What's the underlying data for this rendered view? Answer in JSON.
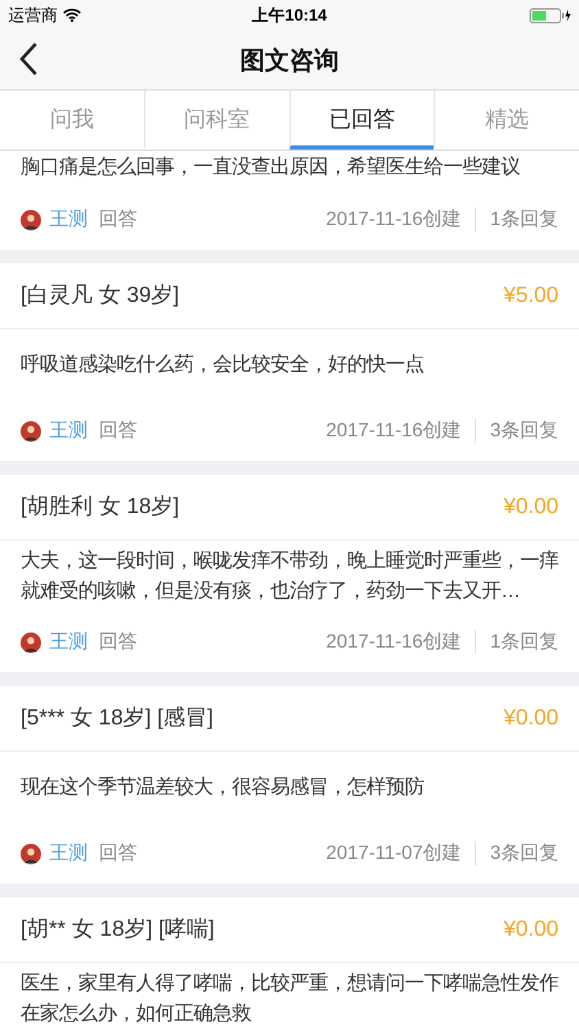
{
  "status_bar": {
    "carrier": "运营商",
    "time": "上午10:14"
  },
  "nav": {
    "title": "图文咨询"
  },
  "tabs": [
    {
      "label": "问我",
      "selected": false
    },
    {
      "label": "问科室",
      "selected": false
    },
    {
      "label": "已回答",
      "selected": true
    },
    {
      "label": "精选",
      "selected": false
    }
  ],
  "questions": [
    {
      "text": "胸口痛是怎么回事，一直没查出原因，希望医生给一些建议",
      "doctor": "王测",
      "action": "回答",
      "created": "2017-11-16创建",
      "replies": "1条回复"
    },
    {
      "patient": "[白灵凡 女 39岁]",
      "price": "¥5.00",
      "text": "呼吸道感染吃什么药，会比较安全，好的快一点",
      "doctor": "王测",
      "action": "回答",
      "created": "2017-11-16创建",
      "replies": "3条回复"
    },
    {
      "patient": "[胡胜利 女 18岁]",
      "price": "¥0.00",
      "text": "大夫，这一段时间，喉咙发痒不带劲，晚上睡觉时严重些，一痒就难受的咳嗽，但是没有痰，也治疗了，药劲一下去又开…",
      "doctor": "王测",
      "action": "回答",
      "created": "2017-11-16创建",
      "replies": "1条回复"
    },
    {
      "patient": "[5*** 女 18岁] [感冒]",
      "price": "¥0.00",
      "text": "现在这个季节温差较大，很容易感冒，怎样预防",
      "doctor": "王测",
      "action": "回答",
      "created": "2017-11-07创建",
      "replies": "3条回复"
    },
    {
      "patient": "[胡** 女 18岁] [哮喘]",
      "price": "¥0.00",
      "text": "医生，家里有人得了哮喘，比较严重，想请问一下哮喘急性发作在家怎么办，如何正确急救"
    }
  ]
}
